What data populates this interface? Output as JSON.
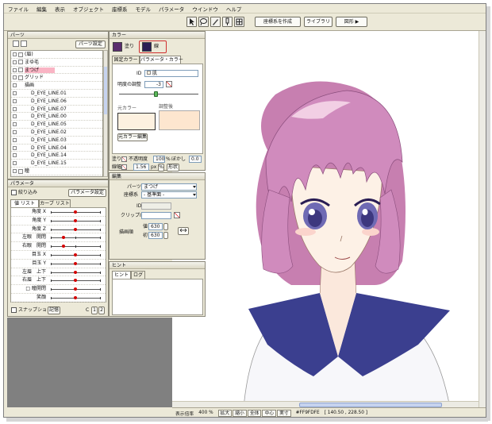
{
  "menu": [
    "ファイル",
    "編集",
    "表示",
    "オブジェクト",
    "座標系",
    "モデル",
    "パラメータ",
    "ウインドウ",
    "ヘルプ"
  ],
  "toolbar": {
    "create_coord": "座標系を作成",
    "library": "ライブラリ",
    "shape": "図形 ▶"
  },
  "parts_panel": {
    "title": "パーツ",
    "settings_button": "パーツ設定",
    "tree": [
      {
        "label": "(眉)",
        "indent": 1
      },
      {
        "label": "まゆ毛",
        "indent": 1
      },
      {
        "label": "まつげ",
        "indent": 1,
        "selected": true
      },
      {
        "label": "グリッド",
        "indent": 1
      },
      {
        "label": "描画",
        "indent": 2
      },
      {
        "label": "D_EYE_LINE.01",
        "indent": 3
      },
      {
        "label": "D_EYE_LINE.06",
        "indent": 3
      },
      {
        "label": "D_EYE_LINE.07",
        "indent": 3
      },
      {
        "label": "D_EYE_LINE.00",
        "indent": 3
      },
      {
        "label": "D_EYE_LINE.05",
        "indent": 3
      },
      {
        "label": "D_EYE_LINE.02",
        "indent": 3
      },
      {
        "label": "D_EYE_LINE.03",
        "indent": 3
      },
      {
        "label": "D_EYE_LINE.04",
        "indent": 3
      },
      {
        "label": "D_EYE_LINE.14",
        "indent": 3
      },
      {
        "label": "D_EYE_LINE.15",
        "indent": 3
      },
      {
        "label": "瞳",
        "indent": 1
      }
    ]
  },
  "param_panel": {
    "title": "パラメータ",
    "narrow_label": "絞り込み",
    "settings_button": "パラメータ設定",
    "tabs": [
      "値 リスト",
      "カーブ リスト"
    ],
    "params": [
      {
        "label": "角度 X",
        "value": 0.5
      },
      {
        "label": "角度 Y",
        "value": 0.5
      },
      {
        "label": "角度 Z",
        "value": 0.5
      },
      {
        "label": "左眼　開閉",
        "value": 0.25
      },
      {
        "label": "右眼　開閉",
        "value": 0.25
      },
      {
        "label": "目玉 X",
        "value": 0.5
      },
      {
        "label": "目玉 Y",
        "value": 0.5
      },
      {
        "label": "左眉　上下",
        "value": 0.5
      },
      {
        "label": "右眉　上下",
        "value": 0.5
      },
      {
        "label": "□ 瞳開閉",
        "value": 0.5
      },
      {
        "label": "笑顔",
        "value": 0.5
      }
    ],
    "snapshot_label": "スナップショット",
    "memory_button": "記憶",
    "c_label": "C",
    "page1": "1",
    "page2": "2"
  },
  "color_panel": {
    "title": "カラー",
    "fill_label": "塗り",
    "line_label": "線",
    "tabs": [
      "固定カラー",
      "パラメータ・カラー"
    ],
    "id_label": "ID",
    "id_value": "肌",
    "brightness_label": "明度の調整",
    "brightness_value": "-3",
    "original_label": "元カラー",
    "adjusted_label": "調整後",
    "edit_original_button": "元カラー編集",
    "fill_row": "塗り",
    "opacity_label": "不透明度",
    "opacity_value": "100",
    "percent": "%",
    "blur_label": "ぼかし",
    "blur_value": "0.0",
    "line_width_label": "線幅",
    "line_width_value": "1.56",
    "px": "px",
    "shape_button": "形状",
    "colors": {
      "fill": "#5a2d6e",
      "line": "#2a1d54",
      "original": "#fdf1e0",
      "adjusted": "#fde6cf"
    }
  },
  "edit_panel": {
    "title": "編集",
    "parts_label": "パーツ",
    "parts_value": "まつげ",
    "coord_label": "座標系",
    "coord_value": "- 基準面 -",
    "id_label": "ID",
    "clip_label": "クリップID",
    "draw_order_label": "描画順",
    "current_label": "値",
    "current_value": "630",
    "default_label": "初",
    "default_value": "630"
  },
  "hint_panel": {
    "title": "ヒント",
    "tabs": [
      "ヒント",
      "ログ"
    ]
  },
  "status": {
    "zoom_label": "表示倍率",
    "zoom_value": "400 %",
    "zoom_in": "拡大",
    "zoom_out": "縮小",
    "fit_all": "全体",
    "center": "中心",
    "actual": "実寸",
    "color_value": "#FF9FDFE",
    "coords": "[ 140.50 , 228.50 ]"
  }
}
